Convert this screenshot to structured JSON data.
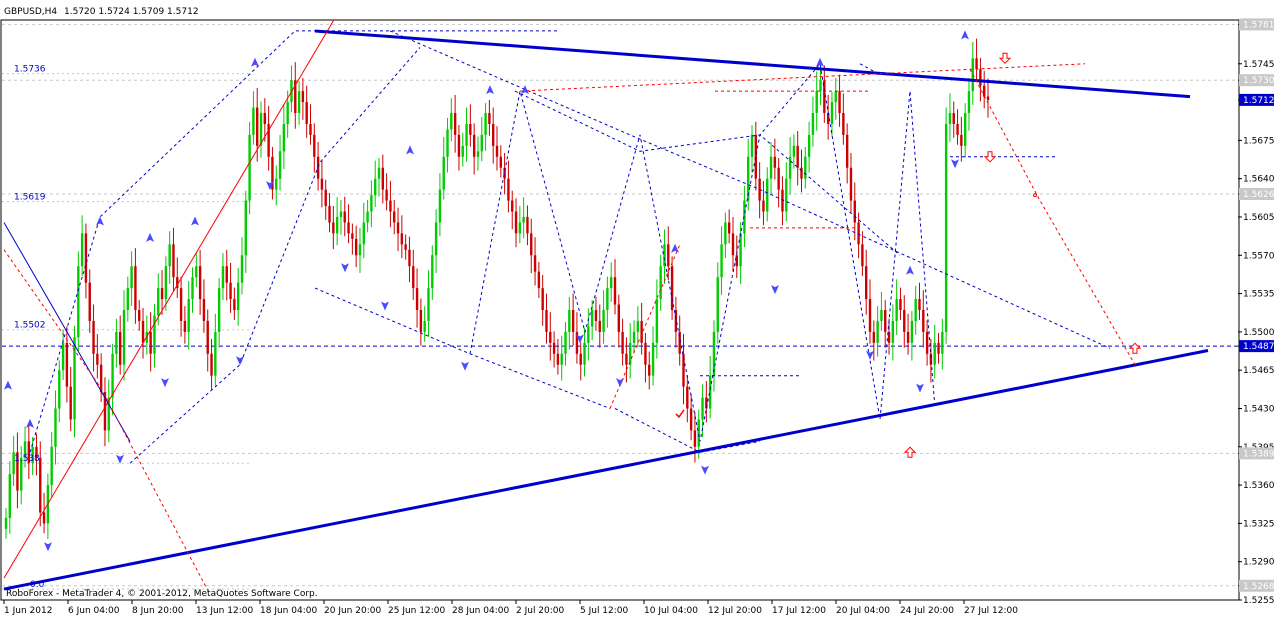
{
  "header": {
    "symbol": "GBPUSD,H4",
    "ohlc": "1.5720 1.5724 1.5709 1.5712"
  },
  "footer": {
    "copyright": "RoboForex - MetaTrader 4, © 2001-2012, MetaQuotes Software Corp."
  },
  "level_labels": [
    "1.5736",
    "1.5619",
    "1.5502",
    "1.538",
    "0.0"
  ],
  "chart_data": {
    "type": "candlestick",
    "title": "",
    "xlabel": "",
    "ylabel": "",
    "ylim": [
      1.5255,
      1.5785
    ],
    "grid": false,
    "x_ticks": [
      "1 Jun 2012",
      "6 Jun 04:00",
      "8 Jun 20:00",
      "13 Jun 12:00",
      "18 Jun 04:00",
      "20 Jun 20:00",
      "25 Jun 12:00",
      "28 Jun 04:00",
      "2 Jul 20:00",
      "5 Jul 12:00",
      "10 Jul 04:00",
      "12 Jul 20:00",
      "17 Jul 12:00",
      "20 Jul 04:00",
      "24 Jul 20:00",
      "27 Jul 12:00"
    ],
    "y_ticks": [
      "1.5781",
      "1.5745",
      "1.5730",
      "1.5712",
      "1.5675",
      "1.5640",
      "1.5626",
      "1.5605",
      "1.5570",
      "1.5535",
      "1.5500",
      "1.5487",
      "1.5465",
      "1.5430",
      "1.5395",
      "1.5389",
      "1.5360",
      "1.5325",
      "1.5290",
      "1.5268",
      "1.5255"
    ],
    "current_price": 1.5712,
    "horizontal_levels": [
      1.5487
    ],
    "colors": {
      "up": "#00cc00",
      "down": "#cc0000",
      "trend": "#0000cc",
      "projection": "#ff0000",
      "current_label": "#0000cc"
    },
    "closes": [
      1.533,
      1.537,
      1.539,
      1.5355,
      1.5385,
      1.54,
      1.538,
      1.5395,
      1.5385,
      1.5335,
      1.5325,
      1.536,
      1.5395,
      1.543,
      1.5465,
      1.549,
      1.545,
      1.542,
      1.5495,
      1.556,
      1.559,
      1.5545,
      1.551,
      1.548,
      1.547,
      1.5445,
      1.541,
      1.544,
      1.548,
      1.55,
      1.547,
      1.552,
      1.554,
      1.556,
      1.552,
      1.551,
      1.549,
      1.55,
      1.548,
      1.5515,
      1.554,
      1.553,
      1.556,
      1.558,
      1.555,
      1.554,
      1.551,
      1.55,
      1.553,
      1.555,
      1.556,
      1.553,
      1.551,
      1.548,
      1.546,
      1.55,
      1.554,
      1.556,
      1.5545,
      1.553,
      1.552,
      1.5545,
      1.557,
      1.562,
      1.568,
      1.5705,
      1.567,
      1.57,
      1.569,
      1.566,
      1.563,
      1.564,
      1.5665,
      1.569,
      1.571,
      1.573,
      1.57,
      1.572,
      1.571,
      1.569,
      1.568,
      1.566,
      1.564,
      1.563,
      1.5615,
      1.56,
      1.559,
      1.5605,
      1.561,
      1.56,
      1.559,
      1.5585,
      1.557,
      1.558,
      1.56,
      1.561,
      1.5625,
      1.564,
      1.565,
      1.563,
      1.562,
      1.561,
      1.56,
      1.559,
      1.558,
      1.5575,
      1.556,
      1.554,
      1.552,
      1.55,
      1.551,
      1.554,
      1.557,
      1.56,
      1.563,
      1.566,
      1.5685,
      1.57,
      1.568,
      1.566,
      1.567,
      1.569,
      1.568,
      1.566,
      1.5665,
      1.568,
      1.57,
      1.569,
      1.567,
      1.566,
      1.565,
      1.564,
      1.562,
      1.561,
      1.559,
      1.56,
      1.5605,
      1.559,
      1.557,
      1.5555,
      1.554,
      1.552,
      1.55,
      1.549,
      1.548,
      1.547,
      1.548,
      1.55,
      1.552,
      1.55,
      1.548,
      1.547,
      1.549,
      1.5505,
      1.552,
      1.551,
      1.55,
      1.552,
      1.554,
      1.555,
      1.5525,
      1.55,
      1.548,
      1.547,
      1.549,
      1.55,
      1.551,
      1.549,
      1.547,
      1.546,
      1.549,
      1.553,
      1.556,
      1.558,
      1.556,
      1.552,
      1.55,
      1.548,
      1.545,
      1.543,
      1.541,
      1.5395,
      1.542,
      1.544,
      1.543,
      1.546,
      1.55,
      1.555,
      1.558,
      1.56,
      1.559,
      1.557,
      1.556,
      1.559,
      1.562,
      1.566,
      1.568,
      1.564,
      1.562,
      1.561,
      1.564,
      1.566,
      1.565,
      1.563,
      1.561,
      1.564,
      1.566,
      1.567,
      1.565,
      1.564,
      1.566,
      1.568,
      1.57,
      1.572,
      1.573,
      1.57,
      1.569,
      1.571,
      1.572,
      1.57,
      1.568,
      1.565,
      1.562,
      1.56,
      1.558,
      1.556,
      1.553,
      1.55,
      1.549,
      1.551,
      1.552,
      1.55,
      1.549,
      1.551,
      1.553,
      1.552,
      1.55,
      1.549,
      1.551,
      1.553,
      1.552,
      1.55,
      1.548,
      1.547,
      1.549,
      1.548,
      1.55,
      1.569,
      1.57,
      1.569,
      1.568,
      1.567,
      1.57,
      1.572,
      1.575,
      1.574,
      1.5725,
      1.5715,
      1.5712
    ]
  }
}
